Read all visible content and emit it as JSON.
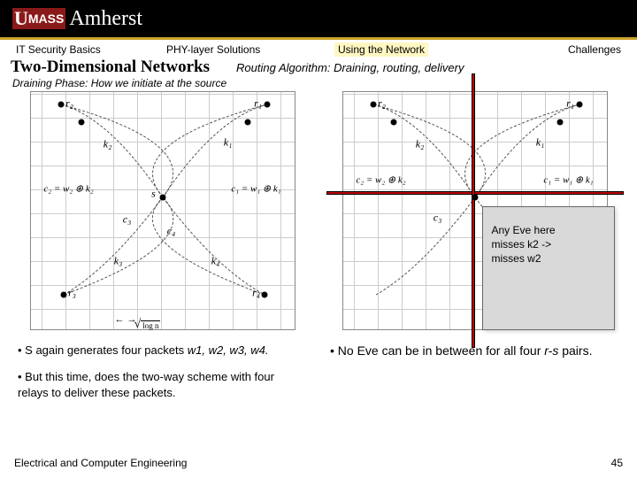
{
  "logo": {
    "u": "U",
    "mass": "MASS",
    "amherst": "Amherst"
  },
  "nav": {
    "item1": "IT Security Basics",
    "item2": "PHY-layer Solutions",
    "item3": "Using the Network",
    "item4": "Challenges"
  },
  "title": "Two-Dimensional Networks",
  "subtitle": "Routing Algorithm: Draining, routing, delivery",
  "phase": "Draining Phase: How we initiate at the source",
  "labels": {
    "r1": "r₁",
    "r2": "r₂",
    "r3": "r₃",
    "r4": "r₄",
    "k1": "k₁",
    "k2": "k₂",
    "k3": "k₃",
    "k4": "k₄",
    "c3": "c₃",
    "c4": "c₄",
    "s": "s",
    "eq_left": "c₂ = w₂ ⊕ k₂",
    "eq_right": "c₁ = w₁ ⊕ k₁",
    "sqrt": "log n",
    "arrows": "←  →"
  },
  "callout": {
    "line1": "Any Eve here",
    "line2": "misses k2 ->",
    "line3": "misses w2"
  },
  "bullets": {
    "b1a": "• S again generates four packets ",
    "b1b": "w1, w2, w3, w4.",
    "b2": "• But this time, does the two-way scheme with four relays to deliver these packets."
  },
  "right_bullet": {
    "t1": "• No Eve can be in between for all four ",
    "t2": "r-s",
    "t3": " pairs."
  },
  "footer": {
    "left": "Electrical and Computer Engineering",
    "right": "45"
  }
}
